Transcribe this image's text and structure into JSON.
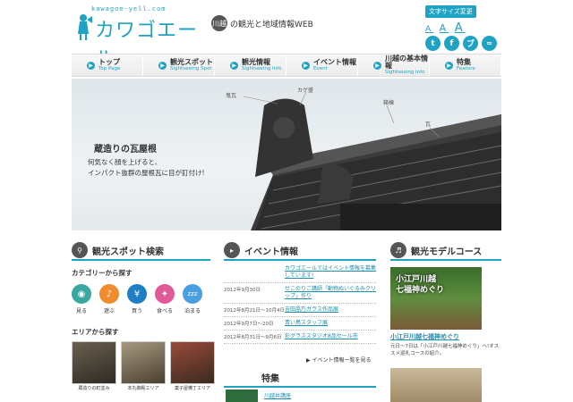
{
  "header": {
    "logo_url": "kawagoe-yell.com",
    "logo_text": "カワゴエール",
    "tag_circle": "川越",
    "tagline": "の観光と地域情報WEB",
    "font_size_label": "文字サイズ変更",
    "font_size_options": [
      "A",
      "A",
      "A"
    ],
    "social": [
      "t",
      "f",
      "ブ",
      "rss"
    ]
  },
  "nav": [
    {
      "jp": "トップ",
      "en": "Top Page"
    },
    {
      "jp": "観光スポット",
      "en": "Sightseeing Spot"
    },
    {
      "jp": "観光情報",
      "en": "Sightseeing Info"
    },
    {
      "jp": "イベント情報",
      "en": "Event"
    },
    {
      "jp": "川越の基本情報",
      "en": "Sightseeing Info"
    },
    {
      "jp": "特集",
      "en": "Feature"
    }
  ],
  "hero": {
    "title": "蔵造りの瓦屋根",
    "desc_line1": "何気なく顔を上げると、",
    "desc_line2": "インパクト抜群の屋根瓦に目が釘付け!",
    "labels": [
      "鬼瓦",
      "カゲ盛",
      "箱棟",
      "瓦"
    ]
  },
  "spots": {
    "title": "観光スポット検索",
    "cat_heading": "カテゴリーから探す",
    "categories": [
      {
        "label": "見る",
        "icon": "camera-icon",
        "color": "#3aa8a0"
      },
      {
        "label": "遊ぶ",
        "icon": "note-icon",
        "color": "#f08c2e"
      },
      {
        "label": "買う",
        "icon": "yen-icon",
        "color": "#1f7fc4"
      },
      {
        "label": "食べる",
        "icon": "fork-knife-icon",
        "color": "#e05a9a"
      },
      {
        "label": "泊まる",
        "icon": "zzz-icon",
        "color": "#4a9fe0"
      }
    ],
    "area_heading": "エリアから探す",
    "areas": [
      {
        "label": "蔵造りの町並み"
      },
      {
        "label": "本丸御殿エリア"
      },
      {
        "label": "菓子屋横丁エリア"
      }
    ]
  },
  "events": {
    "title": "イベント情報",
    "rows": [
      {
        "date": "",
        "title": "カワゴエールではイベント情報を募集しています!"
      },
      {
        "date": "2012年9月30日",
        "title": "せこのりご講師「動物ぬいぐるみクリップ」作り"
      },
      {
        "date": "2012年8月21日〜10月4日",
        "title": "吉田晶乃ガラス作品展"
      },
      {
        "date": "2012年9月7日〜20日",
        "title": "青い鳥スタッフ展"
      },
      {
        "date": "2012年8月31日〜9月6日",
        "title": "彩グラススタジオ8品セール市"
      }
    ],
    "more": "イベント情報一覧を見る"
  },
  "feature": {
    "title": "特集",
    "item": "川越井講座"
  },
  "course": {
    "title": "観光モデルコース",
    "image_text_line1": "小江戸川越",
    "image_text_line2": "七福神めぐり",
    "link": "小江戸川越七福神めぐり",
    "desc": "元日〜7日は「小江戸川越七福神めぐり」へ!オススメ巡礼コースの紹介。"
  },
  "colors": {
    "accent": "#1fa3c4",
    "link": "#1f8fb0"
  }
}
